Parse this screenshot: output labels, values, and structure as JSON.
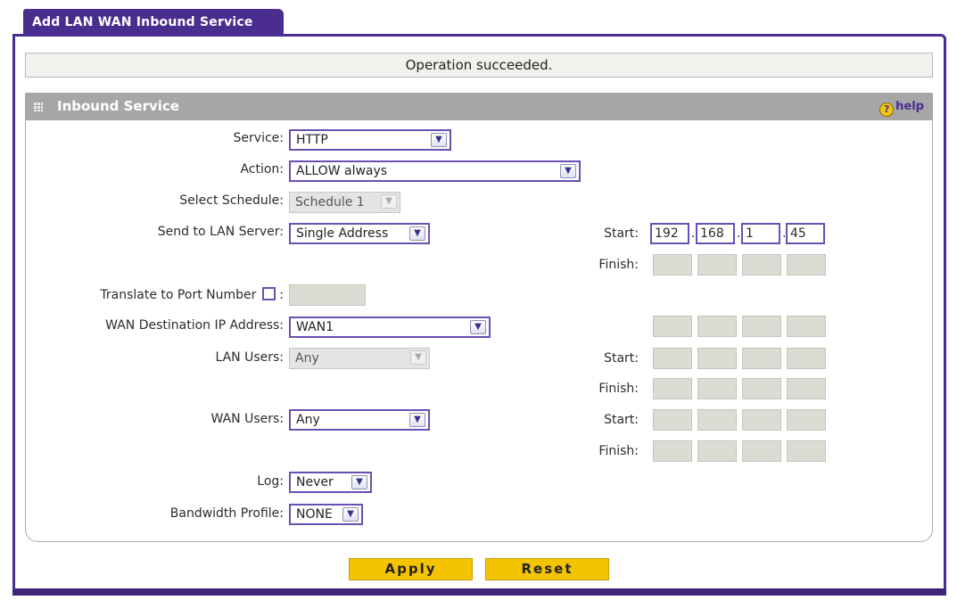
{
  "tab_title": "Add LAN WAN Inbound Service",
  "status_message": "Operation succeeded.",
  "section": {
    "title": "Inbound Service",
    "help_label": "help",
    "help_glyph": "?"
  },
  "form": {
    "service_label": "Service:",
    "service_value": "HTTP",
    "action_label": "Action:",
    "action_value": "ALLOW always",
    "schedule_label": "Select Schedule:",
    "schedule_value": "Schedule 1",
    "lan_server_label": "Send to LAN Server:",
    "lan_server_value": "Single Address",
    "translate_label": "Translate to Port Number",
    "translate_colon": ":",
    "wan_dest_label": "WAN Destination IP Address:",
    "wan_dest_value": "WAN1",
    "lan_users_label": "LAN Users:",
    "lan_users_value": "Any",
    "wan_users_label": "WAN Users:",
    "wan_users_value": "Any",
    "log_label": "Log:",
    "log_value": "Never",
    "bandwidth_label": "Bandwidth Profile:",
    "bandwidth_value": "NONE",
    "start_label": "Start:",
    "finish_label": "Finish:",
    "lan_server_ip": [
      "192",
      "168",
      "1",
      "45"
    ]
  },
  "buttons": {
    "apply": "Apply",
    "reset": "Reset"
  },
  "colors": {
    "accent": "#4a2d8f",
    "button": "#f5c400",
    "section_header": "#a6a6a6"
  }
}
